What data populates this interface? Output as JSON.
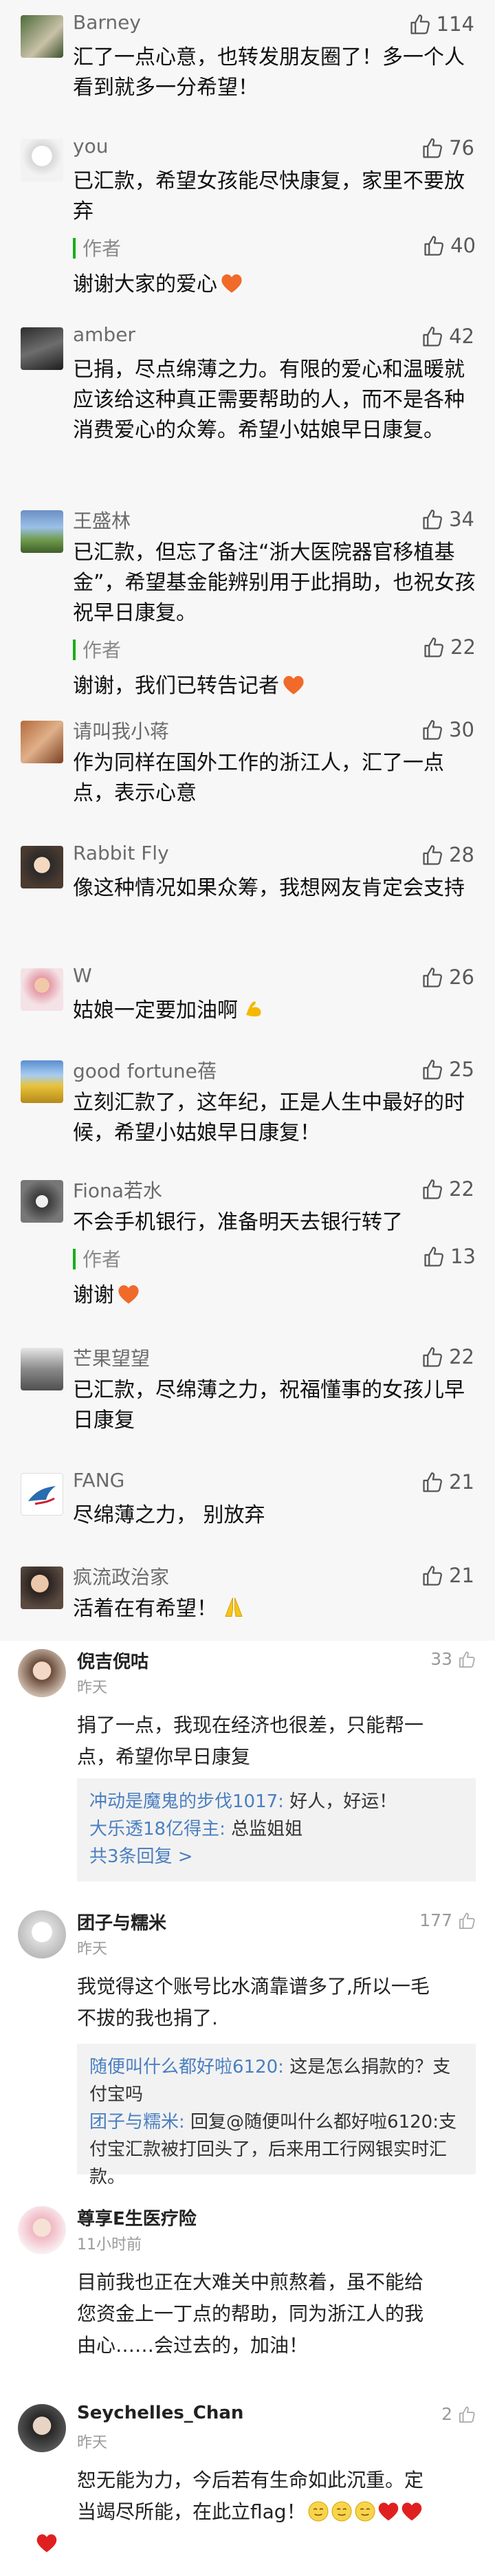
{
  "colors": {
    "section1_bg": "#f7f7f7",
    "author_bar": "#1aad19",
    "link_blue": "#4a7fc1",
    "text_dark": "#111111",
    "text_gray": "#6b6b6b",
    "heart": "#f06a2a"
  },
  "wechat_comments": [
    {
      "name": "Barney",
      "likes": "114",
      "text": "汇了一点心意，也转发朋友圈了！多一个人看到就多一分希望！"
    },
    {
      "name": "you",
      "likes": "76",
      "text": "已汇款，希望女孩能尽快康复，家里不要放弃",
      "reply": {
        "author": "作者",
        "likes": "40",
        "text": "谢谢大家的爱心"
      }
    },
    {
      "name": "amber",
      "likes": "42",
      "text": "已捐，尽点绵薄之力。有限的爱心和温暖就应该给这种真正需要帮助的人，而不是各种消费爱心的众筹。希望小姑娘早日康复。"
    },
    {
      "name": "王盛林",
      "likes": "34",
      "text": "已汇款，但忘了备注“浙大医院器官移植基金”，希望基金能辨别用于此捐助，也祝女孩祝早日康复。",
      "reply": {
        "author": "作者",
        "likes": "22",
        "text": "谢谢，我们已转告记者"
      }
    },
    {
      "name": "请叫我小蒋",
      "likes": "30",
      "text": "作为同样在国外工作的浙江人，汇了一点点，表示心意"
    },
    {
      "name": "Rabbit Fly",
      "likes": "28",
      "text": "像这种情况如果众筹，我想网友肯定会支持"
    },
    {
      "name": "W",
      "likes": "26",
      "text": "姑娘一定要加油啊"
    },
    {
      "name": "good fortune蓓",
      "likes": "25",
      "text": "立刻汇款了，这年纪，正是人生中最好的时候，希望小姑娘早日康复！"
    },
    {
      "name": "Fiona若水",
      "likes": "22",
      "text": "不会手机银行，准备明天去银行转了",
      "reply": {
        "author": "作者",
        "likes": "13",
        "text": "谢谢"
      }
    },
    {
      "name": "芒果望望",
      "likes": "22",
      "text": "已汇款，尽绵薄之力，祝福懂事的女孩儿早日康复"
    },
    {
      "name": "FANG",
      "likes": "21",
      "text": "尽绵薄之力， 别放弃"
    },
    {
      "name": "疯流政治家",
      "likes": "21",
      "text": "活着在有希望！"
    }
  ],
  "weibo_comments": [
    {
      "name": "倪吉倪咕",
      "time": "昨天",
      "likes": "33",
      "text_lines": [
        "捐了一点，我现在经济也很差，只能帮一",
        "点，希望你早日康复"
      ],
      "replies": [
        {
          "who": "冲动是魔鬼的步伐1017:",
          "text": " 好人，好运！"
        },
        {
          "who": "大乐透18亿得主:",
          "text": " 总监姐姐"
        }
      ],
      "more": "共3条回复 >"
    },
    {
      "name": "团子与糯米",
      "time": "昨天",
      "likes": "177",
      "text_lines": [
        "我觉得这个账号比水滴靠谱多了,所以一毛",
        "不拔的我也捐了."
      ],
      "replies": [
        {
          "who": "随便叫什么都好啦6120:",
          "text": " 这是怎么捐款的？支付宝吗"
        },
        {
          "who": "团子与糯米:",
          "text": " 回复@随便叫什么都好啦6120:支付宝汇款被打回头了，后来用工行网银实时汇款。"
        }
      ]
    },
    {
      "name": "尊享E生医疗险",
      "time": "11小时前",
      "likes": "",
      "text_lines": [
        "目前我也正在大难关中煎熬着，虽不能给",
        "您资金上一丁点的帮助，同为浙江人的我",
        "由心……会过去的，加油！"
      ]
    },
    {
      "name": "Seychelles_Chan",
      "time": "昨天",
      "likes": "2",
      "text_lines": [
        "恕无能为力，今后若有生命如此沉重。定",
        "当竭尽所能，在此立flag！"
      ]
    }
  ]
}
